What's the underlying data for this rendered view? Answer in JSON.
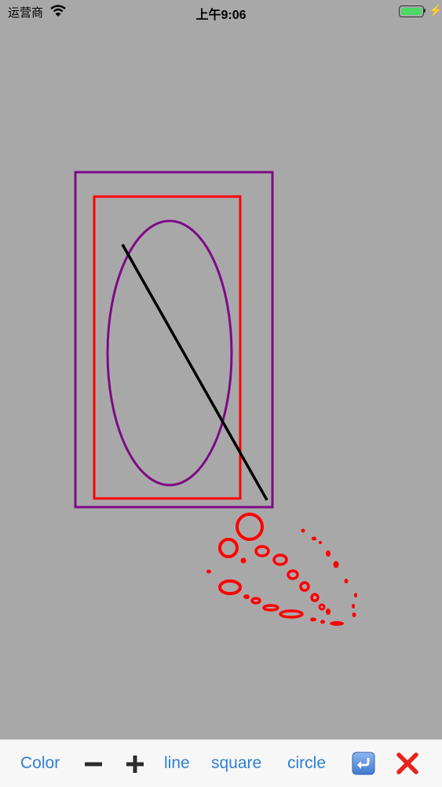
{
  "status_bar": {
    "carrier": "运营商",
    "time": "上午9:06",
    "battery_color": "#4cd964"
  },
  "canvas": {
    "background": "#a9a8a9",
    "drawn_shapes": [
      "rectangle",
      "rectangle",
      "ellipse",
      "line",
      "freehand-circles"
    ],
    "colors": {
      "purple": "#7d0a85",
      "red": "#ff0000",
      "black": "#000000"
    }
  },
  "toolbar": {
    "color_label": "Color",
    "line_label": "line",
    "square_label": "square",
    "circle_label": "circle",
    "icons": [
      "minus-icon",
      "plus-icon",
      "undo-icon",
      "close-icon"
    ],
    "accent": "#2f7fd6",
    "close_color": "#e8231a"
  }
}
